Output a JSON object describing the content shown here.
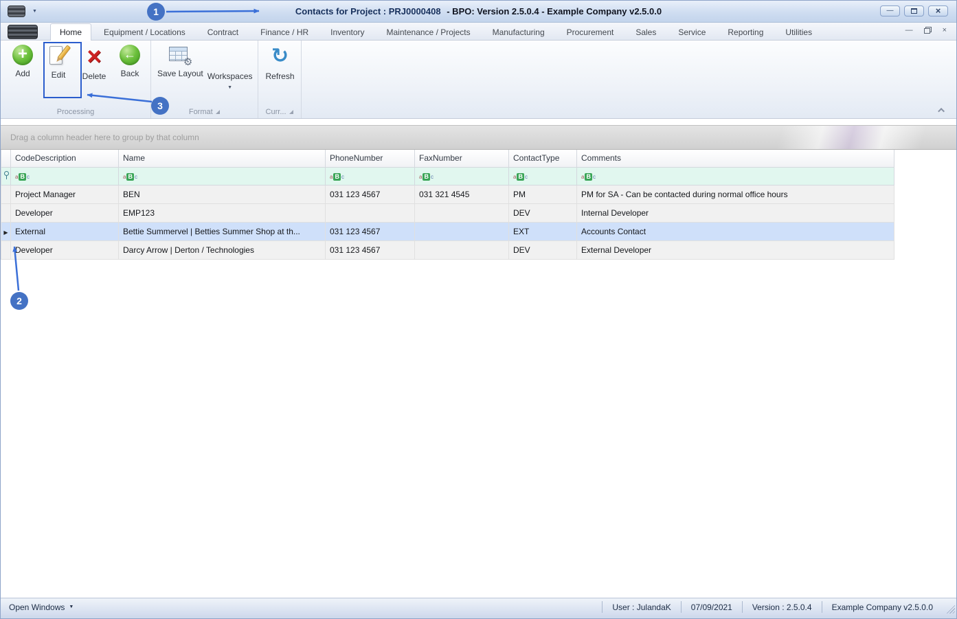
{
  "window": {
    "title_left": "Contacts for Project : PRJ0000408",
    "title_right": "- BPO: Version 2.5.0.4 - Example Company v2.5.0.0"
  },
  "icons": {
    "dropdown": "▼",
    "minimize": "—",
    "close": "×",
    "add": "+",
    "delete": "×",
    "back": "←",
    "refresh": "↻",
    "gear": "⚙",
    "row_arrow": "▶"
  },
  "ribbon": {
    "tabs": [
      {
        "label": "Home",
        "active": true
      },
      {
        "label": "Equipment / Locations"
      },
      {
        "label": "Contract"
      },
      {
        "label": "Finance / HR"
      },
      {
        "label": "Inventory"
      },
      {
        "label": "Maintenance / Projects"
      },
      {
        "label": "Manufacturing"
      },
      {
        "label": "Procurement"
      },
      {
        "label": "Sales"
      },
      {
        "label": "Service"
      },
      {
        "label": "Reporting"
      },
      {
        "label": "Utilities"
      }
    ],
    "groups": [
      {
        "label": "Processing",
        "buttons": [
          {
            "label": "Add",
            "icon": "add-icon"
          },
          {
            "label": "Edit",
            "icon": "edit-icon"
          },
          {
            "label": "Delete",
            "icon": "delete-icon"
          },
          {
            "label": "Back",
            "icon": "back-icon"
          }
        ]
      },
      {
        "label": "Format",
        "buttons": [
          {
            "label": "Save Layout",
            "icon": "save-layout-icon"
          },
          {
            "label": "Workspaces",
            "icon": "workspaces-icon",
            "has_dropdown": true
          }
        ]
      },
      {
        "label": "Curr...",
        "buttons": [
          {
            "label": "Refresh",
            "icon": "refresh-icon"
          }
        ]
      }
    ]
  },
  "grid": {
    "group_hint": "Drag a column header here to group by that column",
    "columns": [
      "CodeDescription",
      "Name",
      "PhoneNumber",
      "FaxNumber",
      "ContactType",
      "Comments"
    ],
    "filter_icon": {
      "a": "a",
      "b": "B",
      "c": "c"
    },
    "rows": [
      {
        "cells": [
          "Project Manager",
          "BEN",
          "031 123 4567",
          "031 321 4545",
          "PM",
          "PM for SA - Can be contacted during normal office hours"
        ]
      },
      {
        "cells": [
          "Developer",
          "EMP123",
          "",
          "",
          "DEV",
          "Internal Developer"
        ]
      },
      {
        "cells": [
          "External",
          "Bettie Summervel | Betties Summer Shop at th...",
          "031 123 4567",
          "",
          "EXT",
          "Accounts Contact"
        ],
        "selected": true
      },
      {
        "cells": [
          "Developer",
          "Darcy Arrow | Derton / Technologies",
          "031 123 4567",
          "",
          "DEV",
          "External Developer"
        ]
      }
    ]
  },
  "statusbar": {
    "open_windows": "Open Windows",
    "user": "User : JulandaK",
    "date": "07/09/2021",
    "version": "Version : 2.5.0.4",
    "company": "Example Company v2.5.0.0"
  },
  "annotations": {
    "color": "#4472C4",
    "items": [
      {
        "label": "1",
        "target": "window-title"
      },
      {
        "label": "2",
        "target": "selected-row-indicator"
      },
      {
        "label": "3",
        "target": "edit-button"
      }
    ]
  },
  "colors": {
    "annotation_blue": "#4472C4",
    "selection_blue": "#cfe0fa",
    "filter_row_mint": "#e1f7ef",
    "icon_green": "#4aa02c",
    "icon_red": "#cc2222",
    "icon_blue": "#3a8cc8"
  }
}
